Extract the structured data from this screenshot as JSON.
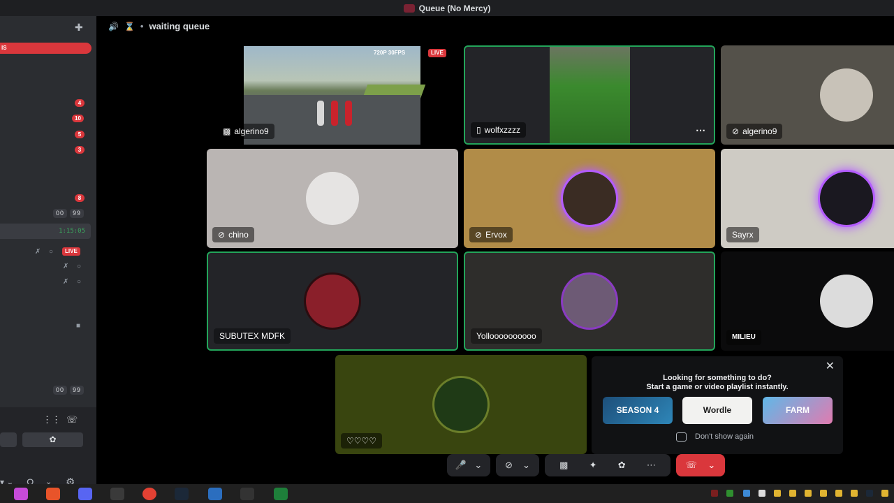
{
  "window": {
    "title": "Queue (No Mercy)"
  },
  "header": {
    "channel": "waiting queue"
  },
  "sidebar": {
    "red_bar_text": "IS",
    "badges": [
      "4",
      "10",
      "5",
      "3",
      "8"
    ],
    "counters": [
      "00",
      "99",
      "00",
      "99"
    ],
    "timer": "1:15:05",
    "live_label": "LIVE"
  },
  "tiles": [
    {
      "name": "algerino9",
      "kind": "stream",
      "quality": "720P 30FPS",
      "live": "LIVE"
    },
    {
      "name": "wolfxzzzz",
      "kind": "stream"
    },
    {
      "name": "algerino9",
      "kind": "video"
    },
    {
      "name": "chino"
    },
    {
      "name": "Ervox"
    },
    {
      "name": "Sayrx"
    },
    {
      "name": "SUBUTEX MDFK"
    },
    {
      "name": "Yolloooooooooo"
    },
    {
      "name": "MILIEU"
    },
    {
      "name": "♡♡♡♡"
    }
  ],
  "suggest": {
    "line1": "Looking for something to do?",
    "line2": "Start a game or video playlist instantly.",
    "cards": [
      "SEASON 4",
      "Wordle",
      "FARM"
    ],
    "dont_show": "Don't show again"
  },
  "controls": [
    "mic",
    "camera",
    "screen share",
    "activities",
    "soundboard",
    "more",
    "leave call"
  ],
  "colors": {
    "accent_green": "#23a55a",
    "danger_red": "#da373c",
    "sidebar": "#2b2d31"
  }
}
